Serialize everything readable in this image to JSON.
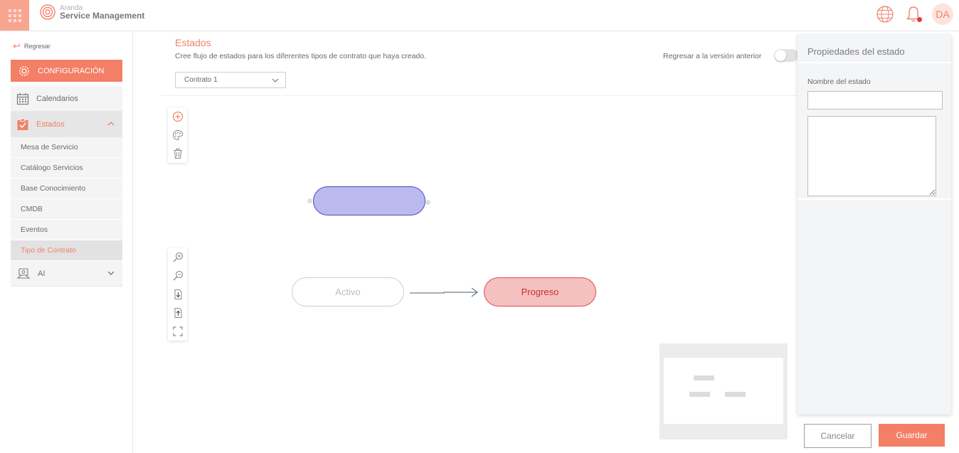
{
  "header": {
    "logo_small": "Aranda",
    "logo_big": "Service Management",
    "avatar_initials": "DA"
  },
  "sidebar": {
    "back_label": "Regresar",
    "config_label": "CONFIGURACIÓN",
    "items": [
      {
        "label": "Calendarios",
        "icon": "calendar-icon"
      },
      {
        "label": "Estados",
        "icon": "checklist-icon",
        "expanded": true
      },
      {
        "label": "AI",
        "icon": "ai-icon",
        "expanded": false
      }
    ],
    "subitems": [
      {
        "label": "Mesa de Servicio"
      },
      {
        "label": "Catálogo Servicios"
      },
      {
        "label": "Base Conocimiento"
      },
      {
        "label": "CMDB"
      },
      {
        "label": "Eventos"
      },
      {
        "label": "Tipo de Contrato",
        "active": true
      }
    ]
  },
  "main": {
    "title": "Estados",
    "description": "Cree flujo de estados para los diferentes tipos de contrato que haya creado.",
    "toggle_label": "Regresar a la versión anterior",
    "toggle_on": false,
    "contract_select": "Contrato 1"
  },
  "diagram": {
    "nodes": [
      {
        "label": "",
        "color": "#babaee"
      },
      {
        "label": "Activo",
        "color": "#ffffff"
      },
      {
        "label": "Progreso",
        "color": "#f5c0c0"
      }
    ]
  },
  "panel": {
    "title": "Propiedades del estado",
    "name_label": "Nombre del estado",
    "name_value": "",
    "description_value": ""
  },
  "actions": {
    "cancel_label": "Cancelar",
    "save_label": "Guardar"
  },
  "colors": {
    "accent": "#f27f66",
    "selected_node": "#babaee",
    "progress_node": "#f5c0c0"
  }
}
